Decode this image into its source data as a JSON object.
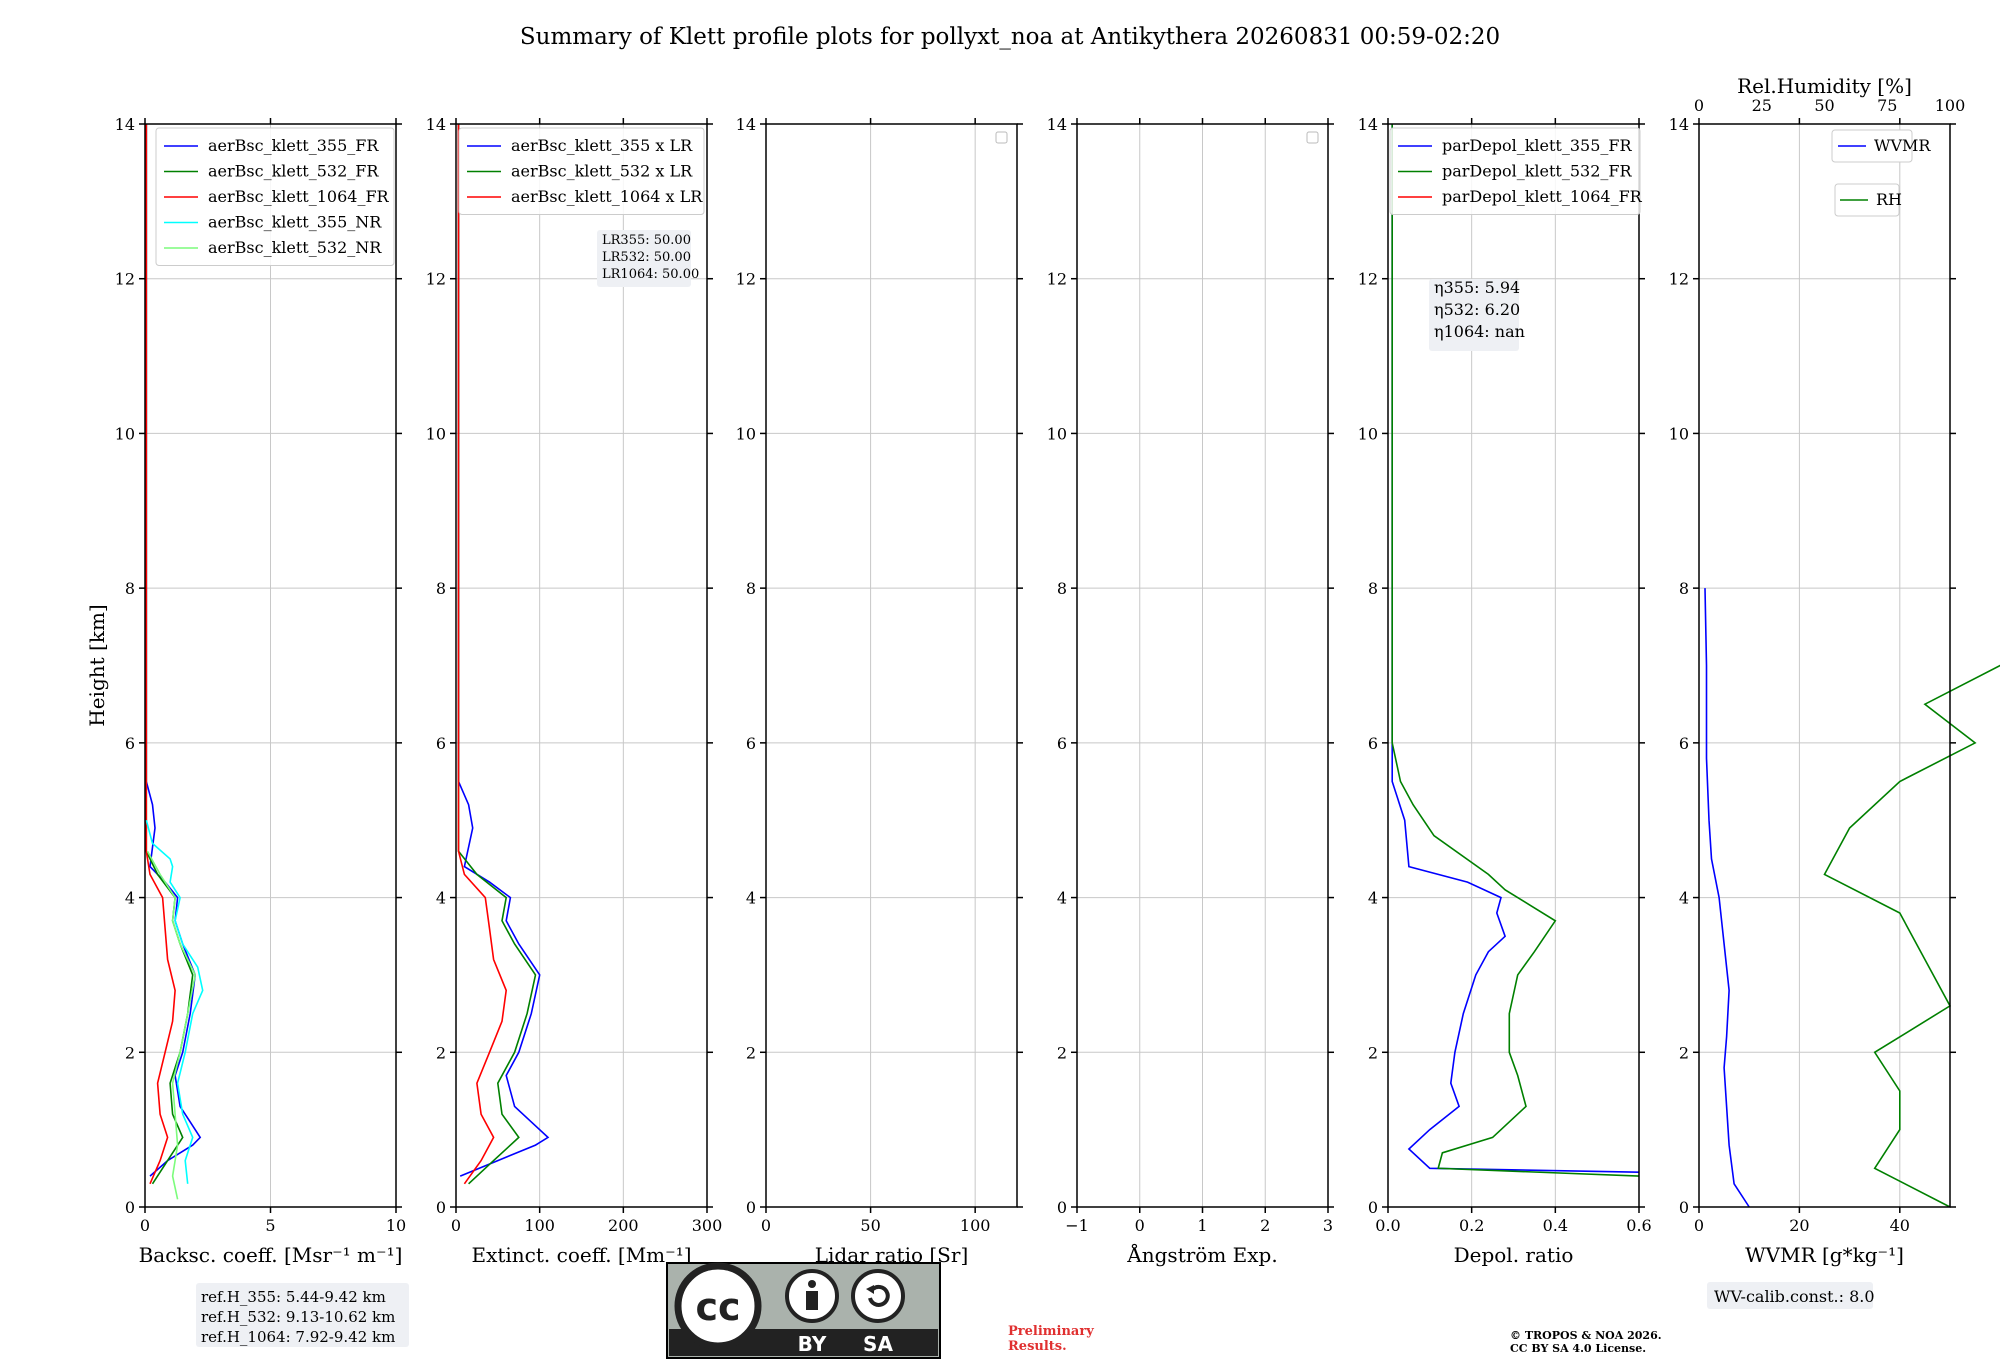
{
  "title": "Summary of Klett profile plots for pollyxt_noa at Antikythera 20260831 00:59-02:20",
  "colors": {
    "c355": "#0000ff",
    "c532": "#008000",
    "c1064": "#ff0000",
    "c355nr": "#00ffff",
    "c532nr": "#7cfc7c",
    "preliminary": "#e03030"
  },
  "chart_data": [
    {
      "type": "line",
      "ylabel": "Height [km]",
      "xlabel": "Backsc. coeff. [Msr⁻¹ m⁻¹]",
      "xlim": [
        0,
        10
      ],
      "ylim": [
        0,
        14
      ],
      "xticks": [
        "0",
        "5",
        "10"
      ],
      "legend": "top-right",
      "series": [
        {
          "name": "aerBsc_klett_355_FR",
          "color": "#0000ff",
          "points": [
            [
              0.2,
              0.4
            ],
            [
              0.9,
              0.6
            ],
            [
              1.9,
              0.8
            ],
            [
              2.2,
              0.9
            ],
            [
              1.8,
              1.1
            ],
            [
              1.4,
              1.3
            ],
            [
              1.2,
              1.7
            ],
            [
              1.5,
              2.0
            ],
            [
              1.8,
              2.5
            ],
            [
              2.0,
              3.0
            ],
            [
              1.5,
              3.4
            ],
            [
              1.2,
              3.7
            ],
            [
              1.3,
              4.0
            ],
            [
              0.8,
              4.2
            ],
            [
              0.2,
              4.4
            ],
            [
              0.4,
              4.9
            ],
            [
              0.3,
              5.2
            ],
            [
              0.05,
              5.5
            ],
            [
              0.05,
              14
            ]
          ]
        },
        {
          "name": "aerBsc_klett_532_FR",
          "color": "#008000",
          "points": [
            [
              0.3,
              0.3
            ],
            [
              0.9,
              0.6
            ],
            [
              1.5,
              0.9
            ],
            [
              1.1,
              1.2
            ],
            [
              1.0,
              1.6
            ],
            [
              1.4,
              2.0
            ],
            [
              1.7,
              2.5
            ],
            [
              1.9,
              3.0
            ],
            [
              1.4,
              3.4
            ],
            [
              1.1,
              3.7
            ],
            [
              1.2,
              4.0
            ],
            [
              0.5,
              4.3
            ],
            [
              0.05,
              4.6
            ],
            [
              0.05,
              14
            ]
          ]
        },
        {
          "name": "aerBsc_klett_1064_FR",
          "color": "#ff0000",
          "points": [
            [
              0.2,
              0.3
            ],
            [
              0.6,
              0.6
            ],
            [
              0.9,
              0.9
            ],
            [
              0.6,
              1.2
            ],
            [
              0.5,
              1.6
            ],
            [
              0.8,
              2.0
            ],
            [
              1.1,
              2.4
            ],
            [
              1.2,
              2.8
            ],
            [
              0.9,
              3.2
            ],
            [
              0.8,
              3.6
            ],
            [
              0.7,
              4.0
            ],
            [
              0.2,
              4.3
            ],
            [
              0.05,
              4.6
            ],
            [
              0.05,
              14
            ]
          ]
        },
        {
          "name": "aerBsc_klett_355_NR",
          "color": "#00ffff",
          "points": [
            [
              1.7,
              0.3
            ],
            [
              1.6,
              0.6
            ],
            [
              1.9,
              0.9
            ],
            [
              1.5,
              1.2
            ],
            [
              1.3,
              1.6
            ],
            [
              1.6,
              2.0
            ],
            [
              1.9,
              2.5
            ],
            [
              2.3,
              2.8
            ],
            [
              2.1,
              3.1
            ],
            [
              1.5,
              3.4
            ],
            [
              1.2,
              3.7
            ],
            [
              1.4,
              4.0
            ],
            [
              1.0,
              4.2
            ],
            [
              1.1,
              4.4
            ],
            [
              1.0,
              4.5
            ],
            [
              0.3,
              4.7
            ],
            [
              0.05,
              5.0
            ]
          ]
        },
        {
          "name": "aerBsc_klett_532_NR",
          "color": "#7cfc7c",
          "points": [
            [
              1.3,
              0.1
            ],
            [
              1.1,
              0.4
            ],
            [
              1.3,
              0.8
            ],
            [
              1.2,
              1.2
            ],
            [
              1.1,
              1.6
            ],
            [
              1.4,
              2.0
            ],
            [
              1.7,
              2.5
            ],
            [
              2.0,
              3.0
            ],
            [
              1.4,
              3.4
            ],
            [
              1.1,
              3.7
            ],
            [
              1.2,
              4.0
            ],
            [
              0.6,
              4.3
            ],
            [
              0.1,
              4.6
            ]
          ]
        }
      ]
    },
    {
      "type": "line",
      "xlabel": "Extinct. coeff. [Mm⁻¹]",
      "xlim": [
        0,
        300
      ],
      "ylim": [
        0,
        14
      ],
      "xticks": [
        "0",
        "100",
        "200",
        "300"
      ],
      "legend": "top-right",
      "series": [
        {
          "name": "aerBsc_klett_355 x LR",
          "color": "#0000ff",
          "points": [
            [
              5,
              0.4
            ],
            [
              50,
              0.6
            ],
            [
              95,
              0.8
            ],
            [
              110,
              0.9
            ],
            [
              90,
              1.1
            ],
            [
              70,
              1.3
            ],
            [
              60,
              1.7
            ],
            [
              75,
              2.0
            ],
            [
              90,
              2.5
            ],
            [
              100,
              3.0
            ],
            [
              75,
              3.4
            ],
            [
              60,
              3.7
            ],
            [
              65,
              4.0
            ],
            [
              40,
              4.2
            ],
            [
              10,
              4.4
            ],
            [
              20,
              4.9
            ],
            [
              15,
              5.2
            ],
            [
              3,
              5.5
            ],
            [
              3,
              14
            ]
          ]
        },
        {
          "name": "aerBsc_klett_532 x LR",
          "color": "#008000",
          "points": [
            [
              15,
              0.3
            ],
            [
              45,
              0.6
            ],
            [
              75,
              0.9
            ],
            [
              55,
              1.2
            ],
            [
              50,
              1.6
            ],
            [
              70,
              2.0
            ],
            [
              85,
              2.5
            ],
            [
              95,
              3.0
            ],
            [
              70,
              3.4
            ],
            [
              55,
              3.7
            ],
            [
              60,
              4.0
            ],
            [
              25,
              4.3
            ],
            [
              3,
              4.6
            ],
            [
              3,
              14
            ]
          ]
        },
        {
          "name": "aerBsc_klett_1064 x LR",
          "color": "#ff0000",
          "points": [
            [
              10,
              0.3
            ],
            [
              30,
              0.6
            ],
            [
              45,
              0.9
            ],
            [
              30,
              1.2
            ],
            [
              25,
              1.6
            ],
            [
              40,
              2.0
            ],
            [
              55,
              2.4
            ],
            [
              60,
              2.8
            ],
            [
              45,
              3.2
            ],
            [
              40,
              3.6
            ],
            [
              35,
              4.0
            ],
            [
              10,
              4.3
            ],
            [
              3,
              4.6
            ],
            [
              3,
              14
            ]
          ]
        }
      ],
      "annotation": [
        "LR355: 50.00",
        "LR532: 50.00",
        "LR1064: 50.00"
      ]
    },
    {
      "type": "line",
      "xlabel": "Lidar ratio [Sr]",
      "xlim": [
        0,
        120
      ],
      "ylim": [
        0,
        14
      ],
      "xticks": [
        "0",
        "50",
        "100"
      ],
      "series": []
    },
    {
      "type": "line",
      "xlabel": "Ångström Exp.",
      "xlim": [
        -1,
        3
      ],
      "ylim": [
        0,
        14
      ],
      "xticks": [
        "−1",
        "0",
        "1",
        "2",
        "3"
      ],
      "series": []
    },
    {
      "type": "line",
      "xlabel": "Depol. ratio",
      "xlim": [
        0,
        0.6
      ],
      "ylim": [
        0,
        14
      ],
      "xticks": [
        "0.0",
        "0.2",
        "0.4",
        "0.6"
      ],
      "legend": "top-right",
      "series": [
        {
          "name": "parDepol_klett_355_FR",
          "color": "#0000ff",
          "points": [
            [
              0.6,
              0.45
            ],
            [
              0.1,
              0.5
            ],
            [
              0.05,
              0.75
            ],
            [
              0.1,
              1.0
            ],
            [
              0.17,
              1.3
            ],
            [
              0.15,
              1.6
            ],
            [
              0.16,
              2.0
            ],
            [
              0.18,
              2.5
            ],
            [
              0.21,
              3.0
            ],
            [
              0.24,
              3.3
            ],
            [
              0.28,
              3.5
            ],
            [
              0.26,
              3.8
            ],
            [
              0.27,
              4.0
            ],
            [
              0.19,
              4.2
            ],
            [
              0.05,
              4.4
            ],
            [
              0.04,
              5.0
            ],
            [
              0.01,
              5.5
            ],
            [
              0.01,
              14
            ]
          ]
        },
        {
          "name": "parDepol_klett_532_FR",
          "color": "#008000",
          "points": [
            [
              0.6,
              0.4
            ],
            [
              0.12,
              0.5
            ],
            [
              0.13,
              0.7
            ],
            [
              0.25,
              0.9
            ],
            [
              0.33,
              1.3
            ],
            [
              0.31,
              1.7
            ],
            [
              0.29,
              2.0
            ],
            [
              0.29,
              2.5
            ],
            [
              0.31,
              3.0
            ],
            [
              0.35,
              3.3
            ],
            [
              0.4,
              3.7
            ],
            [
              0.34,
              3.9
            ],
            [
              0.28,
              4.1
            ],
            [
              0.24,
              4.3
            ],
            [
              0.11,
              4.8
            ],
            [
              0.06,
              5.2
            ],
            [
              0.03,
              5.5
            ],
            [
              0.01,
              6.0
            ],
            [
              0.01,
              14
            ]
          ]
        },
        {
          "name": "parDepol_klett_1064_FR",
          "color": "#ff0000",
          "points": []
        }
      ],
      "annotation": [
        "η355: 5.94",
        "η532: 6.20",
        "η1064: nan"
      ]
    },
    {
      "type": "line",
      "xlabel": "WVMR [g*kg⁻¹]",
      "x2label": "Rel.Humidity [%]",
      "xlim": [
        0,
        50
      ],
      "x2lim": [
        0,
        100
      ],
      "ylim": [
        0,
        14
      ],
      "xticks": [
        "0",
        "20",
        "40"
      ],
      "x2ticks": [
        "0",
        "25",
        "50",
        "75",
        "100"
      ],
      "legend": "top-right",
      "series": [
        {
          "name": "WVMR",
          "color": "#0000ff",
          "points": [
            [
              10,
              0.0
            ],
            [
              7,
              0.3
            ],
            [
              6,
              0.8
            ],
            [
              5.5,
              1.3
            ],
            [
              5,
              1.8
            ],
            [
              5.5,
              2.2
            ],
            [
              6,
              2.8
            ],
            [
              5,
              3.4
            ],
            [
              4,
              4.0
            ],
            [
              2.5,
              4.5
            ],
            [
              2,
              5.0
            ],
            [
              1.5,
              5.8
            ],
            [
              1.5,
              7.0
            ],
            [
              1.2,
              8.0
            ]
          ]
        },
        {
          "name": "RH",
          "color": "#008000",
          "points": [
            [
              50,
              0.0
            ],
            [
              35,
              0.5
            ],
            [
              40,
              1.0
            ],
            [
              40,
              1.5
            ],
            [
              35,
              2.0
            ],
            [
              50,
              2.6
            ],
            [
              45,
              3.2
            ],
            [
              40,
              3.8
            ],
            [
              25,
              4.3
            ],
            [
              30,
              4.9
            ],
            [
              40,
              5.5
            ],
            [
              55,
              6.0
            ],
            [
              45,
              6.5
            ],
            [
              60,
              7.0
            ],
            [
              75,
              7.6
            ],
            [
              95,
              8.2
            ],
            [
              80,
              8.8
            ]
          ]
        }
      ]
    }
  ],
  "ref_heights": [
    "ref.H_355: 5.44-9.42 km",
    "ref.H_532: 9.13-10.62 km",
    "ref.H_1064: 7.92-9.42 km"
  ],
  "wv_calib": "WV-calib.const.: 8.0",
  "license_badge": {
    "cc": "cc",
    "by": "BY",
    "sa": "SA"
  },
  "preliminary": "Preliminary\nResults.",
  "copyright": "© TROPOS & NOA 2026.\nCC BY SA 4.0 License."
}
